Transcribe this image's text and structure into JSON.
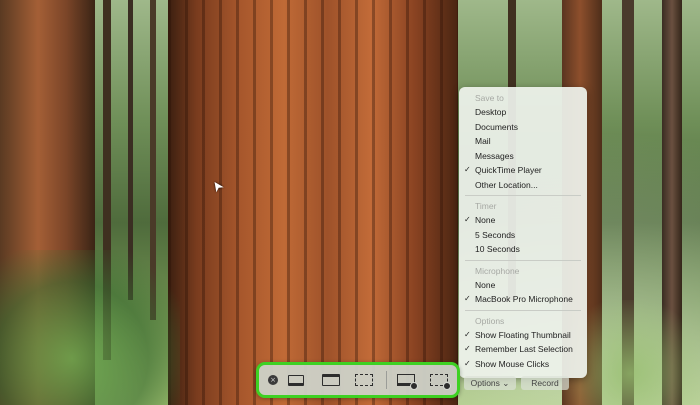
{
  "menu": {
    "save_to_header": "Save to",
    "save_to_items": [
      {
        "label": "Desktop",
        "checked": false
      },
      {
        "label": "Documents",
        "checked": false
      },
      {
        "label": "Mail",
        "checked": false
      },
      {
        "label": "Messages",
        "checked": false
      },
      {
        "label": "QuickTime Player",
        "checked": true
      },
      {
        "label": "Other Location...",
        "checked": false
      }
    ],
    "timer_header": "Timer",
    "timer_items": [
      {
        "label": "None",
        "checked": true
      },
      {
        "label": "5 Seconds",
        "checked": false
      },
      {
        "label": "10 Seconds",
        "checked": false
      }
    ],
    "microphone_header": "Microphone",
    "microphone_items": [
      {
        "label": "None",
        "checked": false
      },
      {
        "label": "MacBook Pro Microphone",
        "checked": true
      }
    ],
    "options_header": "Options",
    "options_items": [
      {
        "label": "Show Floating Thumbnail",
        "checked": true
      },
      {
        "label": "Remember Last Selection",
        "checked": true
      },
      {
        "label": "Show Mouse Clicks",
        "checked": true
      }
    ],
    "check_glyph": "✓"
  },
  "toolbar": {
    "close_glyph": "×",
    "options_label": "Options ⌄",
    "record_label": "Record",
    "highlight_color": "#3ed123"
  },
  "icons": {
    "cursor_glyph": "➤"
  }
}
